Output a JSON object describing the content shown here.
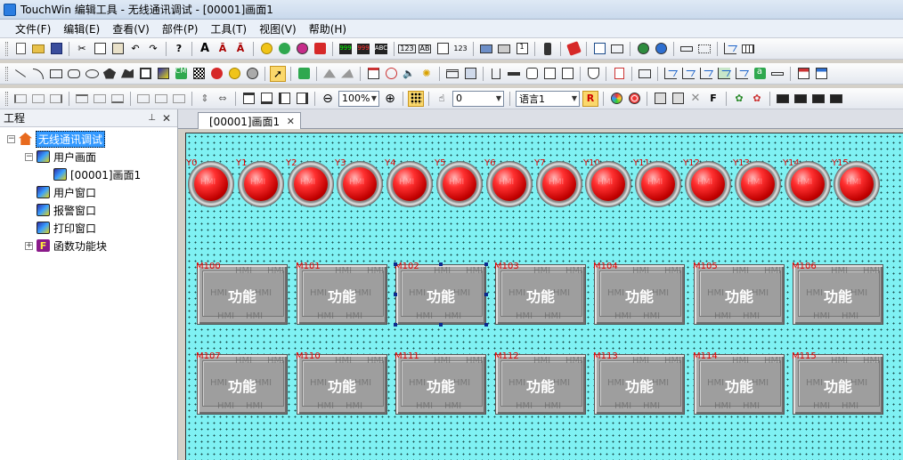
{
  "window": {
    "title": "TouchWin 编辑工具 - 无线通讯调试 - [00001]画面1"
  },
  "menu": [
    "文件(F)",
    "编辑(E)",
    "查看(V)",
    "部件(P)",
    "工具(T)",
    "视图(V)",
    "帮助(H)"
  ],
  "toolbar": {
    "zoom": "100%",
    "state_value": "0",
    "language": "语言1",
    "text_a1": "A",
    "text_a2": "Ā",
    "text_a3": "Ā",
    "btn_f": "F",
    "btn_r": "R",
    "data_123": "123",
    "data_ab": "AB"
  },
  "project_panel": {
    "title": "工程",
    "root": "无线通讯调试",
    "items": [
      {
        "label": "用户画面"
      },
      {
        "label": "[00001]画面1"
      },
      {
        "label": "用户窗口"
      },
      {
        "label": "报警窗口"
      },
      {
        "label": "打印窗口"
      },
      {
        "label": "函数功能块"
      }
    ]
  },
  "document_tab": {
    "label": "[00001]画面1"
  },
  "canvas": {
    "background_color": "#7ff1f3",
    "lamps": [
      "Y0",
      "Y1",
      "Y2",
      "Y3",
      "Y4",
      "Y5",
      "Y6",
      "Y7",
      "Y10",
      "Y11",
      "Y12",
      "Y13",
      "Y14",
      "Y15"
    ],
    "lamp_watermark": "HMI",
    "buttons_row1": [
      "M100",
      "M101",
      "M102",
      "M103",
      "M104",
      "M105",
      "M106"
    ],
    "buttons_row2": [
      "M107",
      "M110",
      "M111",
      "M112",
      "M113",
      "M114",
      "M115"
    ],
    "button_label": "功能",
    "button_watermark": "HMI"
  }
}
